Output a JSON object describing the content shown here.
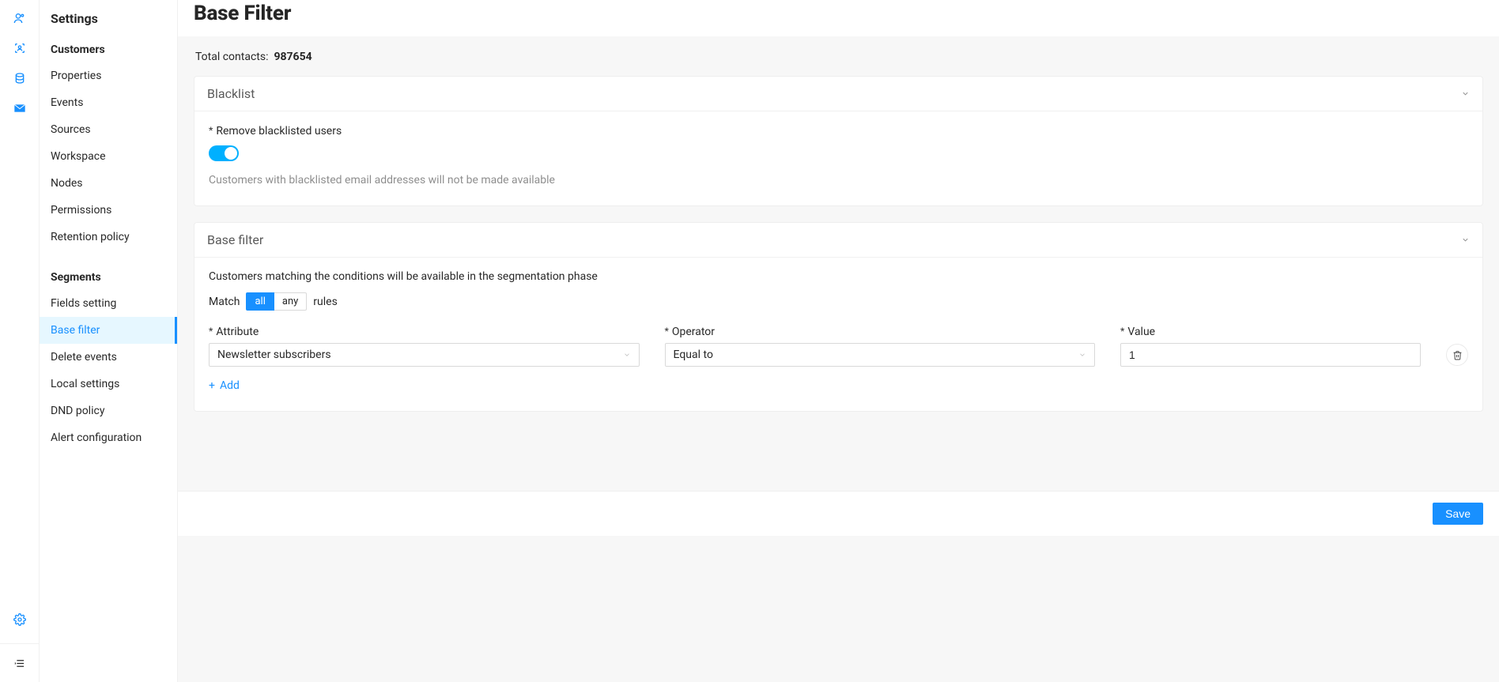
{
  "page_title": "Base Filter",
  "sidebar": {
    "title": "Settings",
    "sections": [
      {
        "label": "Customers",
        "items": [
          "Properties",
          "Events",
          "Sources",
          "Workspace",
          "Nodes",
          "Permissions",
          "Retention policy"
        ]
      },
      {
        "label": "Segments",
        "items": [
          "Fields setting",
          "Base filter",
          "Delete events",
          "Local settings",
          "DND policy",
          "Alert configuration"
        ]
      }
    ],
    "active": "Base filter"
  },
  "total_contacts": {
    "label": "Total contacts:",
    "value": "987654"
  },
  "blacklist_panel": {
    "title": "Blacklist",
    "toggle_label": "Remove blacklisted users",
    "help": "Customers with blacklisted email addresses will not be made available"
  },
  "basefilter_panel": {
    "title": "Base filter",
    "desc": "Customers matching the conditions will be available in the segmentation phase",
    "match_label_pre": "Match",
    "match_options": [
      "all",
      "any"
    ],
    "match_selected": "all",
    "match_label_post": "rules",
    "rule_columns": {
      "attribute": "Attribute",
      "operator": "Operator",
      "value": "Value"
    },
    "rule": {
      "attribute": "Newsletter subscribers",
      "operator": "Equal to",
      "value": "1"
    },
    "add_label": "Add"
  },
  "save_label": "Save"
}
